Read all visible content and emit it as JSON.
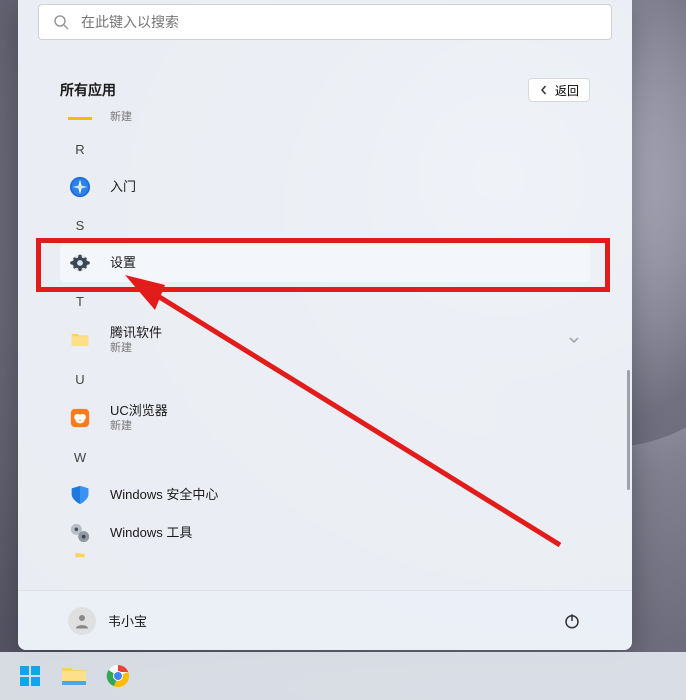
{
  "search": {
    "placeholder": "在此键入以搜索"
  },
  "header": {
    "title": "所有应用",
    "back_label": "返回"
  },
  "partial_top": {
    "sub": "新建"
  },
  "letters": {
    "R": "R",
    "S": "S",
    "T": "T",
    "U": "U",
    "W": "W"
  },
  "apps": {
    "getting_started": "入门",
    "settings": "设置",
    "tencent": {
      "label": "腾讯软件",
      "sub": "新建"
    },
    "uc": {
      "label": "UC浏览器",
      "sub": "新建"
    },
    "security": "Windows 安全中心",
    "tools": "Windows 工具"
  },
  "user": {
    "name": "韦小宝"
  }
}
